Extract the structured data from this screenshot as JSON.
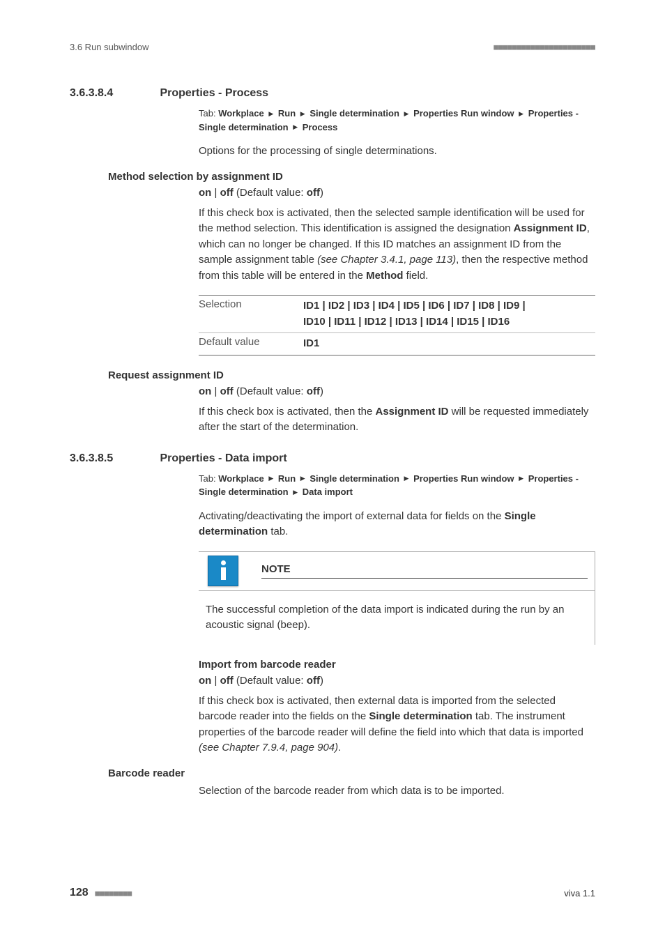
{
  "header": {
    "left": "3.6 Run subwindow",
    "dashes": "■■■■■■■■■■■■■■■■■■■■■■"
  },
  "sec1": {
    "num": "3.6.3.8.4",
    "title": "Properties - Process",
    "tab_label": "Tab: ",
    "path": {
      "p1": "Workplace",
      "p2": "Run",
      "p3": "Single determination",
      "p4": "Properties Run window",
      "p5": "Properties - Single determination",
      "p6": "Process"
    },
    "intro": "Options for the processing of single determinations."
  },
  "method_sel": {
    "heading": "Method selection by assignment ID",
    "toggle_on": "on",
    "toggle_off": "off",
    "toggle_default_label": " (Default value: ",
    "toggle_default_val": "off",
    "toggle_close": ")",
    "para_1a": "If this check box is activated, then the selected sample identification will be used for the method selection. This identification is assigned the designation ",
    "para_1b": "Assignment ID",
    "para_1c": ", which can no longer be changed. If this ID matches an assignment ID from the sample assignment table ",
    "para_1d": "(see Chapter 3.4.1, page 113)",
    "para_1e": ", then the respective method from this table will be entered in the ",
    "para_1f": "Method",
    "para_1g": " field.",
    "sel_label": "Selection",
    "sel_ids_1": "ID1 | ID2 | ID3 | ID4 | ID5 | ID6 | ID7 | ID8 | ID9 |",
    "sel_ids_2": "ID10 | ID11 | ID12 | ID13 | ID14 | ID15 | ID16",
    "def_label": "Default value",
    "def_val": "ID1"
  },
  "request": {
    "heading": "Request assignment ID",
    "toggle_on": "on",
    "toggle_off": "off",
    "toggle_default_label": " (Default value: ",
    "toggle_default_val": "off",
    "toggle_close": ")",
    "para_a": "If this check box is activated, then the ",
    "para_b": "Assignment ID",
    "para_c": " will be requested immediately after the start of the determination."
  },
  "sec2": {
    "num": "3.6.3.8.5",
    "title": "Properties - Data import",
    "tab_label": "Tab: ",
    "path": {
      "p1": "Workplace",
      "p2": "Run",
      "p3": "Single determination",
      "p4": "Properties Run window",
      "p5": "Properties - Single determination",
      "p6": "Data import"
    },
    "intro_a": "Activating/deactivating the import of external data for fields on the ",
    "intro_b": "Single determination",
    "intro_c": " tab."
  },
  "note": {
    "title": "NOTE",
    "body": "The successful completion of the data import is indicated during the run by an acoustic signal (beep)."
  },
  "barcode": {
    "heading": "Import from barcode reader",
    "toggle_on": "on",
    "toggle_off": "off",
    "toggle_default_label": " (Default value: ",
    "toggle_default_val": "off",
    "toggle_close": ")",
    "para_a": "If this check box is activated, then external data is imported from the selected barcode reader into the fields on the ",
    "para_b": "Single determination",
    "para_c": " tab. The instrument properties of the barcode reader will define the field into which that data is imported ",
    "para_d": "(see Chapter 7.9.4, page 904)",
    "para_e": "."
  },
  "reader": {
    "heading": "Barcode reader",
    "para": "Selection of the barcode reader from which data is to be imported."
  },
  "footer": {
    "page": "128",
    "dashes": "■■■■■■■■",
    "right": "viva 1.1"
  }
}
